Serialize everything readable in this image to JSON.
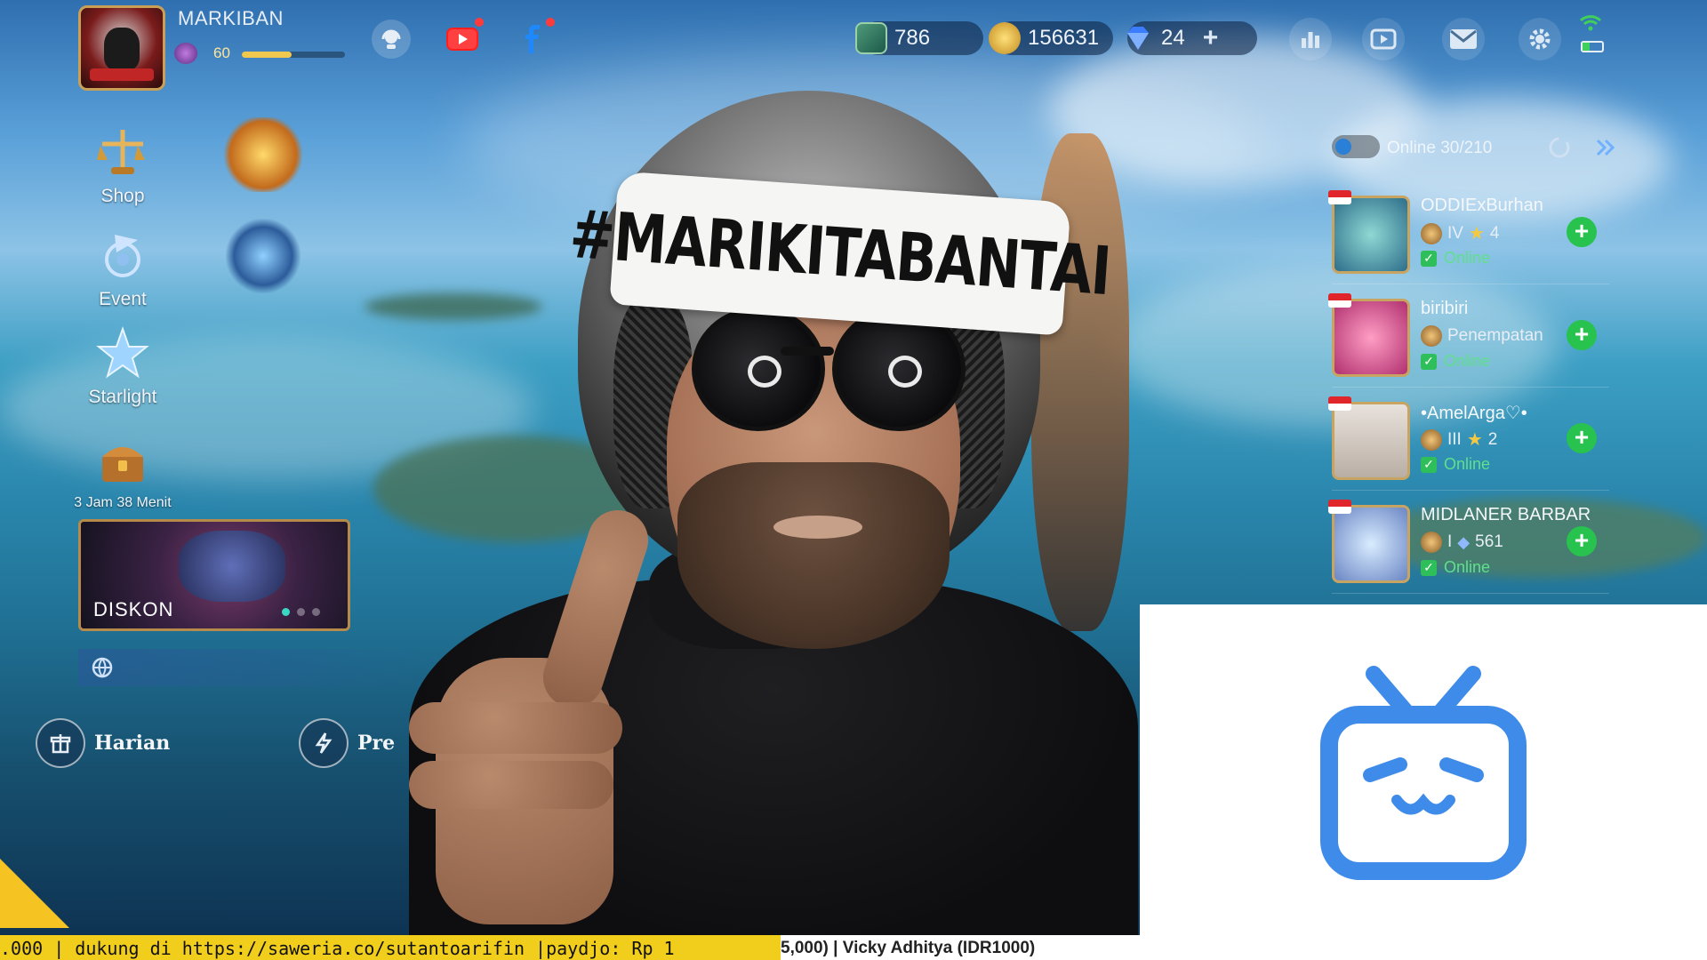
{
  "player": {
    "name": "MARKIBAN",
    "level": "60",
    "xp_fraction": 0.48
  },
  "resources": {
    "tickets": "786",
    "battle_points": "156631",
    "diamonds": "24"
  },
  "left_menu": {
    "shop": "Shop",
    "event": "Event",
    "starlight": "Starlight",
    "timer": "3 Jam 38 Menit"
  },
  "promo": {
    "label": "DISKON"
  },
  "bottom": {
    "harian": "Harian",
    "prev": "Pre"
  },
  "friends": {
    "online": "Online 30/210",
    "list": [
      {
        "name": "ODDIExBurhan",
        "rank": "IV",
        "stars": "4",
        "status": "Online"
      },
      {
        "name": "biribiri",
        "rank": "Penempatan",
        "status": "Online"
      },
      {
        "name": "•AmelArga♡•",
        "rank": "III",
        "stars": "2",
        "status": "Online"
      },
      {
        "name": "MIDLANER BARBAR",
        "rank": "I",
        "points": "561",
        "status": "Online"
      }
    ]
  },
  "webcam": {
    "headband": "#MARIKITABANTAI"
  },
  "ticker": {
    "left": ".000 |  dukung di https://saweria.co/sutantoarifin |paydjo: Rp 1",
    "right": "5,000) | Vicky Adhitya (IDR1000)"
  },
  "colors": {
    "bilibili_blue": "#3f8be9",
    "add_green": "#28c24e",
    "ticker_yellow": "#f2ce1c"
  }
}
